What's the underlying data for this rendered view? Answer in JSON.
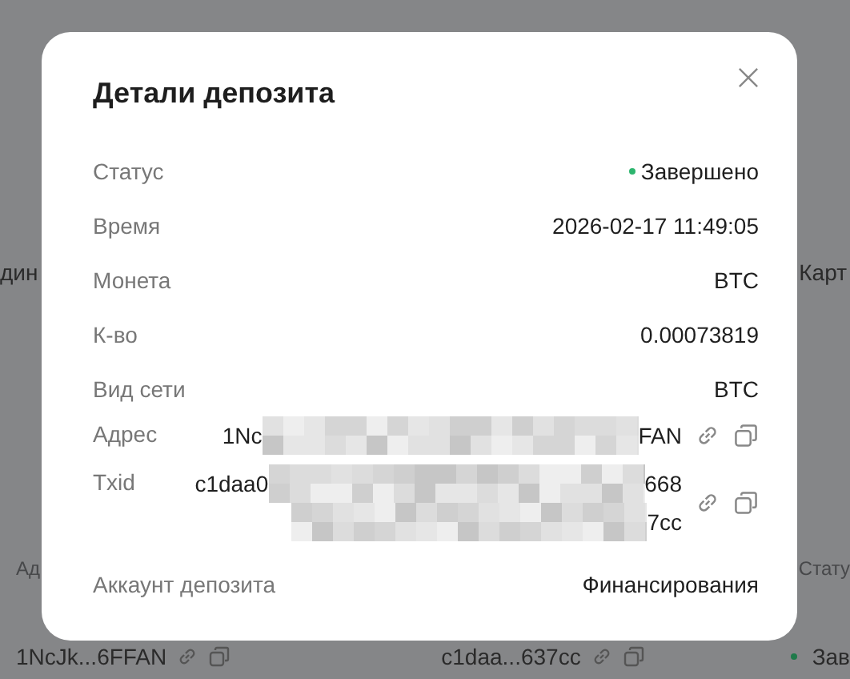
{
  "background": {
    "top_row": {
      "left": "дин",
      "right": "Карт"
    },
    "table_header": {
      "left": "Ад",
      "right": "Стату"
    },
    "table_row": {
      "address": "1NcJk...6FFAN",
      "txid": "c1daa...637cc",
      "status": "Зав"
    }
  },
  "dialog": {
    "title": "Детали депозита",
    "fields": [
      {
        "label": "Статус",
        "kind": "status",
        "value": "Завершено"
      },
      {
        "label": "Время",
        "kind": "text",
        "value": "2026-02-17 11:49:05"
      },
      {
        "label": "Монета",
        "kind": "text",
        "value": "BTC"
      },
      {
        "label": "К-во",
        "kind": "text",
        "value": "0.00073819"
      },
      {
        "label": "Вид сети",
        "kind": "text",
        "value": "BTC"
      },
      {
        "label": "Адрес",
        "kind": "redacted",
        "lines": [
          {
            "start": "1Nc",
            "end": "FAN"
          }
        ]
      },
      {
        "label": "Txid",
        "kind": "redacted",
        "lines": [
          {
            "start": "c1daa0",
            "end": "668"
          },
          {
            "end": "7cc"
          }
        ]
      },
      {
        "label": "Аккаунт депозита",
        "kind": "text",
        "value": "Финансирования"
      }
    ]
  }
}
